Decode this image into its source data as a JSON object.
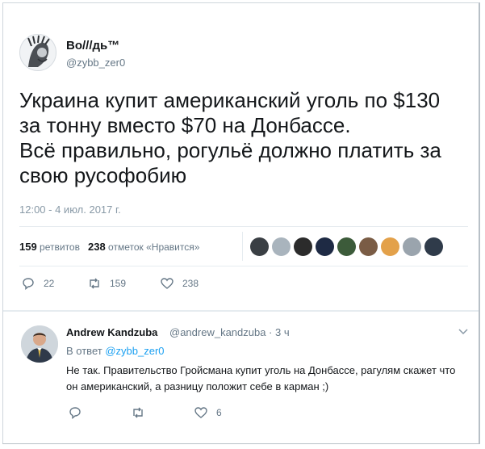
{
  "tweet": {
    "author_name": "Bo///дь™",
    "author_handle": "@zybb_zer0",
    "text_lines": [
      "Украина купит американский уголь по $130",
      "за тонну вместо $70 на Донбассе.",
      "Всё правильно, рогульё должно платить за",
      "свою русофобию"
    ],
    "timestamp": "12:00 - 4 июл. 2017 г.",
    "retweets_count": "159",
    "retweets_label": "ретвитов",
    "likes_count": "238",
    "likes_label": "отметок «Нравится»",
    "liker_colors": [
      "#3a3f44",
      "#a9b4bd",
      "#2b2b2b",
      "#1e2a44",
      "#3c5b3a",
      "#7a5c45",
      "#e3a14a",
      "#9aa4ad",
      "#2f3b4a"
    ],
    "actions": {
      "reply_count": "22",
      "retweet_count": "159",
      "like_count": "238"
    }
  },
  "reply": {
    "author_name": "Andrew Kandzuba",
    "author_handle": "@andrew_kandzuba · 3 ч",
    "in_reply_prefix": "В ответ",
    "in_reply_handle": "@zybb_zer0",
    "text": "Не так. Правительство Гройсмана купит уголь на Донбассе, рагулям скажет что он американский, а разницу положит себе в карман ;)",
    "actions": {
      "reply_count": "",
      "retweet_count": "",
      "like_count": "6"
    }
  },
  "colors": {
    "link": "#1da1f2",
    "muted": "#657786",
    "text": "#14171a"
  }
}
